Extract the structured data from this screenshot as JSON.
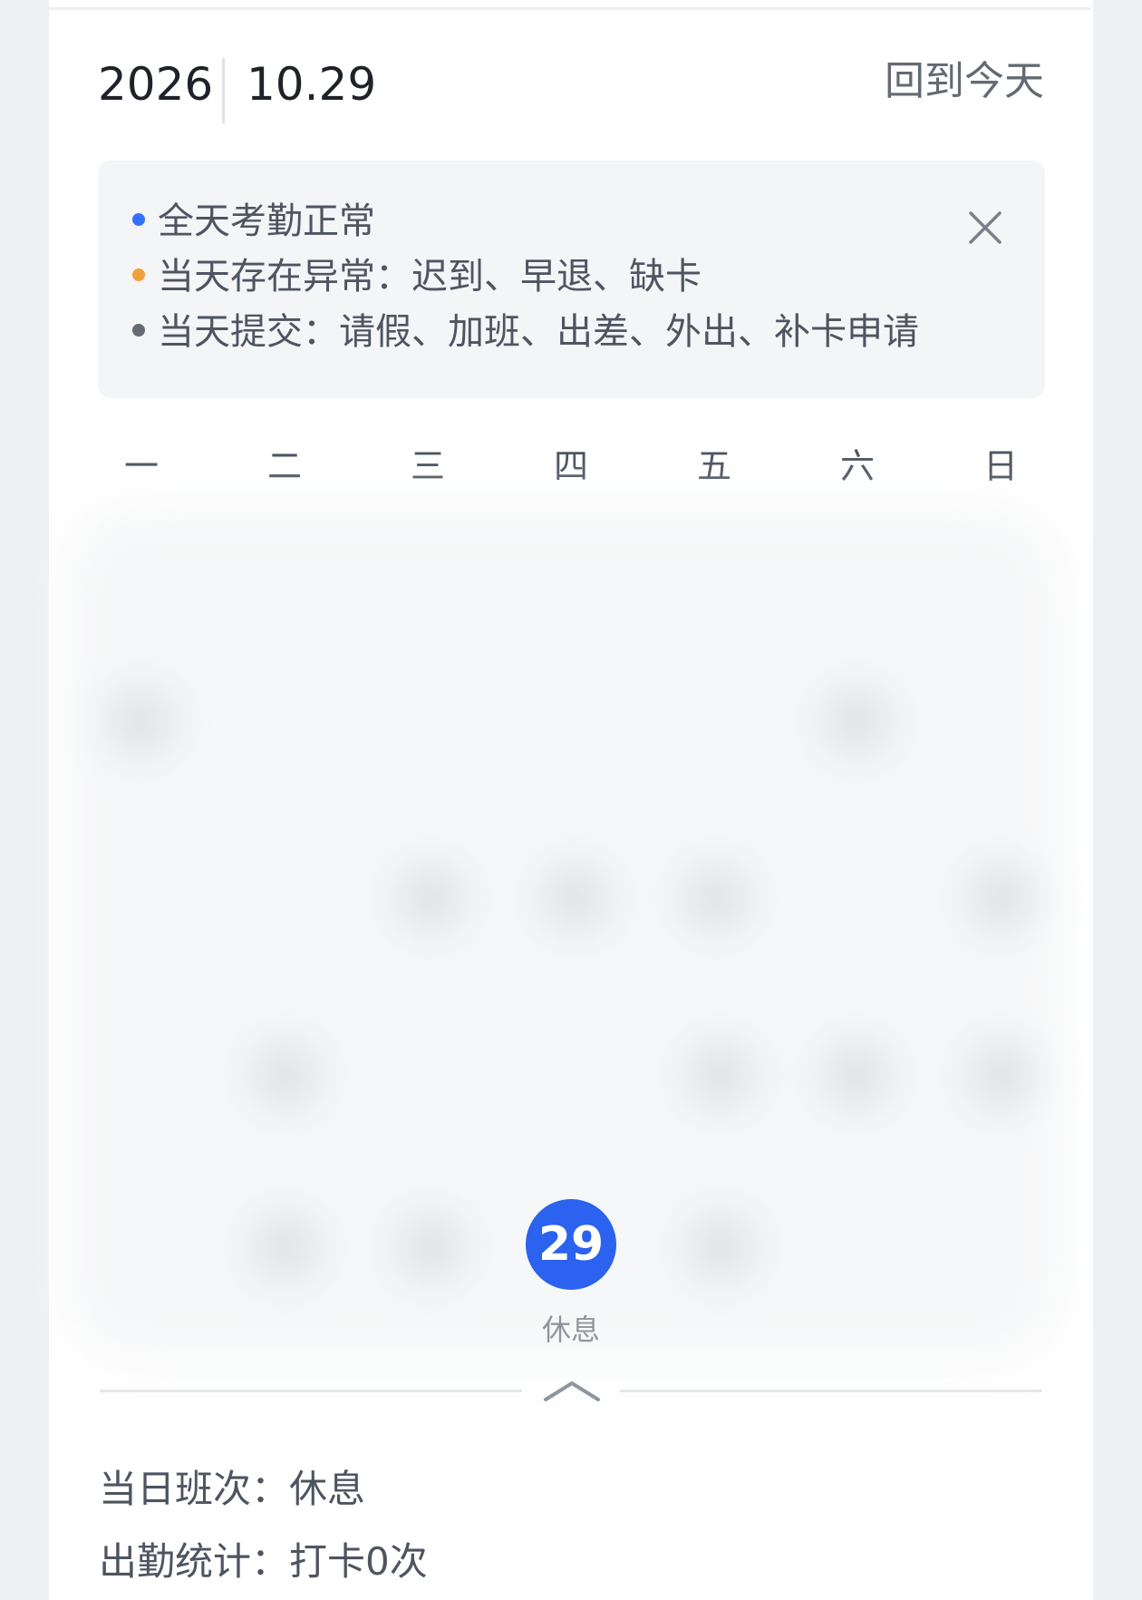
{
  "header": {
    "year": "2026",
    "date": "10.29",
    "today_label": "回到今天"
  },
  "legend": {
    "items": [
      {
        "text": "全天考勤正常",
        "color": "#3370ff"
      },
      {
        "text": "当天存在异常：迟到、早退、缺卡",
        "color": "#f0a03c"
      },
      {
        "text": "当天提交：请假、加班、出差、外出、补卡申请",
        "color": "#646a73"
      }
    ],
    "close_icon": "close-icon"
  },
  "weekdays": [
    "一",
    "二",
    "三",
    "四",
    "五",
    "六",
    "日"
  ],
  "selected_day": {
    "number": "29",
    "status": "休息",
    "color": "#2b62ef"
  },
  "collapse_icon": "chevron-up-icon",
  "details": {
    "shift": "当日班次：休息",
    "stats": "出勤统计：打卡0次"
  }
}
